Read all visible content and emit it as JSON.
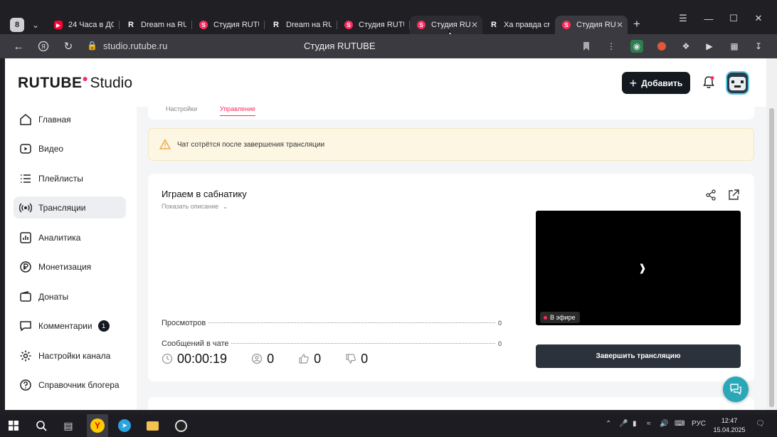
{
  "browser": {
    "tabs": [
      {
        "title": "24 Часа в ДО",
        "favicon": "yt"
      },
      {
        "title": "Dream на RUTU",
        "favicon": "rt"
      },
      {
        "title": "Студия RUTUB",
        "favicon": "st"
      },
      {
        "title": "Dream на RUTU",
        "favicon": "rt"
      },
      {
        "title": "Студия RUTUB",
        "favicon": "st"
      },
      {
        "title": "Студия RU",
        "favicon": "st"
      },
      {
        "title": "Ха правда см",
        "favicon": "rt"
      },
      {
        "title": "Студия RU",
        "favicon": "st"
      }
    ],
    "tab_menu_label": "8",
    "url": "studio.rutube.ru",
    "page_title": "Студия RUTUBE"
  },
  "header": {
    "logo_main": "RUTUBE",
    "logo_studio": "Studio",
    "add_label": "Добавить"
  },
  "sidebar": {
    "items": [
      {
        "label": "Главная"
      },
      {
        "label": "Видео"
      },
      {
        "label": "Плейлисты"
      },
      {
        "label": "Трансляции"
      },
      {
        "label": "Аналитика"
      },
      {
        "label": "Монетизация"
      },
      {
        "label": "Донаты"
      },
      {
        "label": "Комментарии",
        "badge": "1"
      },
      {
        "label": "Настройки канала"
      },
      {
        "label": "Справочник блогера"
      }
    ]
  },
  "subtabs": {
    "settings": "Настройки",
    "manage": "Управление"
  },
  "warning": {
    "text": "Чат сотрётся после завершения трансляции"
  },
  "stream": {
    "title": "Играем в сабнатику",
    "show_description": "Показать описание",
    "stats": [
      {
        "label": "Просмотров",
        "value": "0"
      },
      {
        "label": "Сообщений в чате",
        "value": "0"
      }
    ],
    "live_label": "В эфире",
    "timer": "00:00:19",
    "viewers": "0",
    "likes": "0",
    "dislikes": "0",
    "end_label": "Завершить трансляцию"
  },
  "taskbar": {
    "lang": "РУС",
    "time": "12:47",
    "date": "15.04.2025"
  },
  "colors": {
    "accent": "#ff2b5e",
    "dark": "#14191f",
    "warning_bg": "#fdf6e2"
  }
}
